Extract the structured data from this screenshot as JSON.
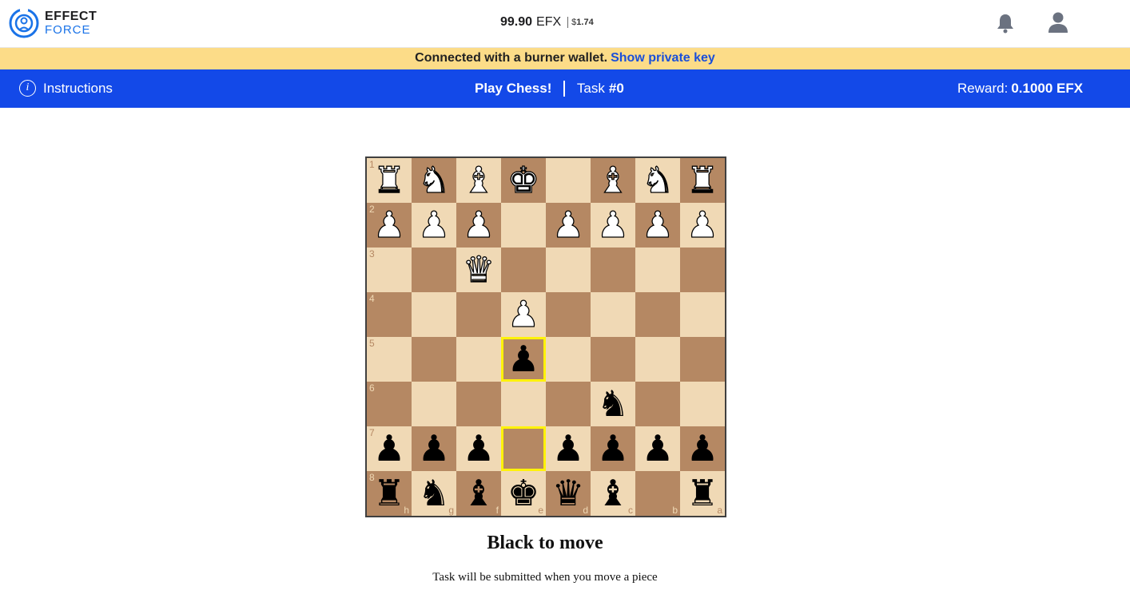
{
  "header": {
    "logo_line1": "EFFECT",
    "logo_line2": "FORCE",
    "balance_amount": "99.90",
    "balance_unit": "EFX",
    "usd_symbol": "$",
    "usd_value": "1.74",
    "icons": [
      "bell-icon",
      "user-icon"
    ]
  },
  "banner": {
    "text": "Connected with a burner wallet.",
    "link": "Show private key",
    "color": "#fcdc88"
  },
  "taskbar": {
    "color": "#1349e8",
    "instructions_icon": "i",
    "instructions_label": "Instructions",
    "title": "Play Chess!",
    "task_label": "Task",
    "task_number": "#0",
    "reward_label": "Reward:",
    "reward_value": "0.1000 EFX"
  },
  "board": {
    "light_color": "#f0d9b5",
    "dark_color": "#b58863",
    "highlight_color": "#fff20a",
    "orientation": "black",
    "rank_labels": [
      "1",
      "2",
      "3",
      "4",
      "5",
      "6",
      "7",
      "8"
    ],
    "file_labels": [
      "h",
      "g",
      "f",
      "e",
      "d",
      "c",
      "b",
      "a"
    ],
    "rows": [
      [
        "R",
        "N",
        "B",
        "K",
        "",
        "B",
        "N",
        "R"
      ],
      [
        "P",
        "P",
        "P",
        "",
        "P",
        "P",
        "P",
        "P"
      ],
      [
        "",
        "",
        "Q",
        "",
        "",
        "",
        "",
        ""
      ],
      [
        "",
        "",
        "",
        "P",
        "",
        "",
        "",
        ""
      ],
      [
        "",
        "",
        "",
        "p",
        "",
        "",
        "",
        ""
      ],
      [
        "",
        "",
        "",
        "",
        "",
        "n",
        "",
        ""
      ],
      [
        "p",
        "p",
        "p",
        "",
        "p",
        "p",
        "p",
        "p"
      ],
      [
        "r",
        "n",
        "b",
        "k",
        "q",
        "b",
        "",
        "r"
      ]
    ],
    "highlighted_squares": [
      "e5",
      "e7"
    ]
  },
  "status": {
    "turn": "Black to move",
    "note": "Task will be submitted when you move a piece"
  }
}
